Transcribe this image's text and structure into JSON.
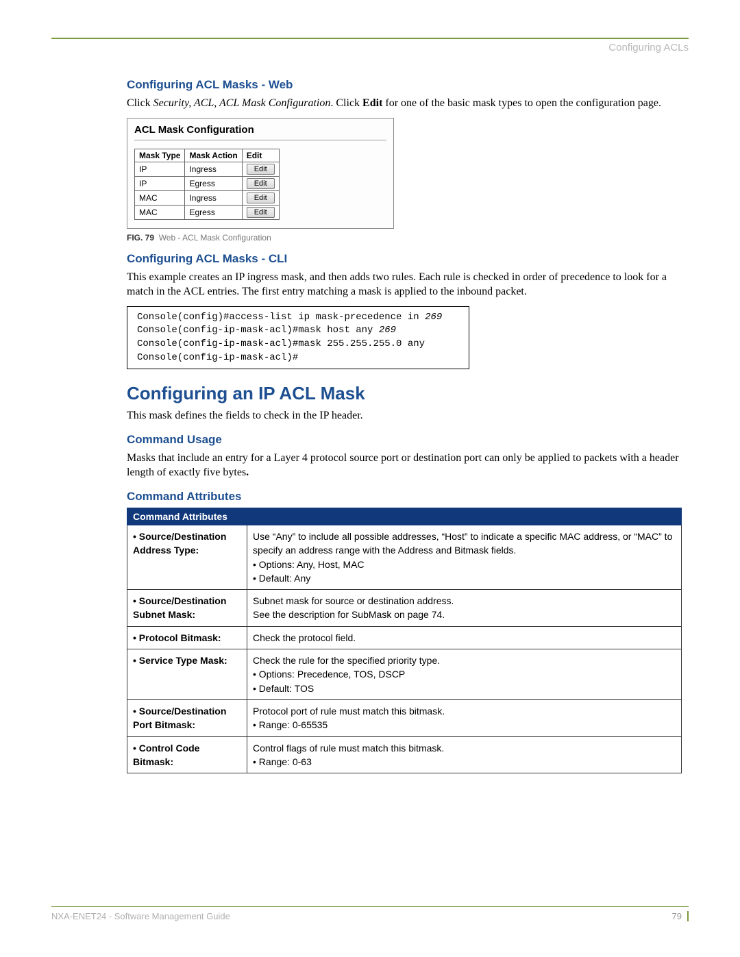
{
  "header": {
    "chapter": "Configuring ACLs"
  },
  "sec_web": {
    "heading": "Configuring ACL Masks - Web",
    "intro_pre": "Click ",
    "intro_italic": "Security, ACL, ACL Mask Configuration",
    "intro_mid": ". Click ",
    "intro_bold": "Edit",
    "intro_post": " for one of the basic mask types to open the configuration page."
  },
  "panel": {
    "title": "ACL Mask Configuration",
    "columns": [
      "Mask Type",
      "Mask Action",
      "Edit"
    ],
    "rows": [
      {
        "type": "IP",
        "action": "Ingress",
        "btn": "Edit"
      },
      {
        "type": "IP",
        "action": "Egress",
        "btn": "Edit"
      },
      {
        "type": "MAC",
        "action": "Ingress",
        "btn": "Edit"
      },
      {
        "type": "MAC",
        "action": "Egress",
        "btn": "Edit"
      }
    ]
  },
  "figcap": {
    "num": "FIG. 79",
    "text": "Web - ACL Mask Configuration"
  },
  "sec_cli": {
    "heading": "Configuring ACL Masks - CLI",
    "intro": "This example creates an IP ingress mask, and then adds two rules. Each rule is checked in order of precedence to look for a match in the ACL entries. The first entry matching a mask is applied to the inbound packet.",
    "lines": [
      {
        "cmd": "Console(config)#access-list ip mask-precedence in ",
        "arg": "269"
      },
      {
        "cmd": "Console(config-ip-mask-acl)#mask host any ",
        "arg": "269"
      },
      {
        "cmd": "Console(config-ip-mask-acl)#mask 255.255.255.0 any",
        "arg": ""
      },
      {
        "cmd": "Console(config-ip-mask-acl)#",
        "arg": ""
      }
    ]
  },
  "sec_ip": {
    "heading": "Configuring an IP ACL Mask",
    "intro": "This mask defines the fields to check in the IP header."
  },
  "cmd_usage": {
    "heading": "Command Usage",
    "text_a": "Masks that include an entry for a Layer 4 protocol source port or destination port can only be applied to packets with a header length of exactly five bytes",
    "text_b": "."
  },
  "cmd_attr": {
    "heading": "Command Attributes",
    "table_header": "Command Attributes",
    "rows": [
      {
        "name": "Source/Destination Address Type:",
        "desc": "Use “Any” to include all possible addresses, “Host” to indicate a specific MAC address, or “MAC” to specify an address range with the Address and Bitmask fields.",
        "sub": [
          "Options: Any, Host, MAC",
          "Default: Any"
        ]
      },
      {
        "name": "Source/Destination Subnet Mask:",
        "desc": "Subnet mask for source or destination address.",
        "extra": "See the description for SubMask on page 74."
      },
      {
        "name": "Protocol Bitmask:",
        "desc": "Check the protocol field."
      },
      {
        "name": "Service Type Mask:",
        "desc": "Check the rule for the specified priority type.",
        "sub": [
          "Options: Precedence, TOS, DSCP",
          "Default: TOS"
        ]
      },
      {
        "name": "Source/Destination Port Bitmask:",
        "desc": "Protocol port of rule must match this bitmask.",
        "sub": [
          "Range: 0-65535"
        ]
      },
      {
        "name": "Control Code Bitmask:",
        "desc": "Control flags of rule must match this bitmask.",
        "sub": [
          "Range: 0-63"
        ]
      }
    ]
  },
  "footer": {
    "left": "NXA-ENET24 - Software Management Guide",
    "right": "79"
  }
}
